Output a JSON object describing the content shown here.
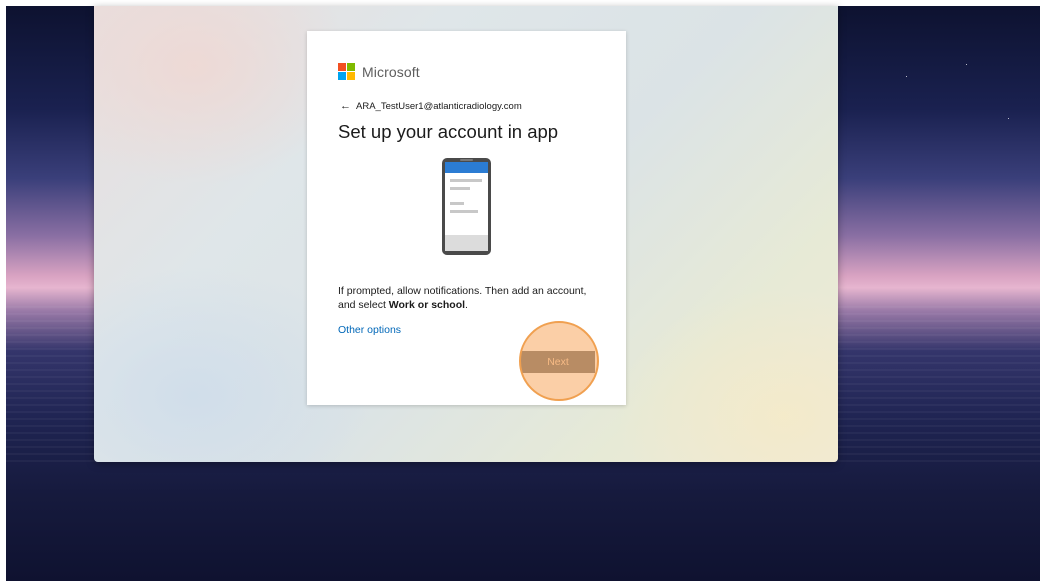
{
  "brand": {
    "name": "Microsoft",
    "logo_colors": [
      "#f25022",
      "#7fba00",
      "#00a4ef",
      "#ffb900"
    ]
  },
  "identity": {
    "back_icon": "back-arrow-icon",
    "back_glyph": "←",
    "email": "ARA_TestUser1@atlanticradiology.com"
  },
  "title": "Set up your account in app",
  "illustration": "phone-illustration",
  "description": {
    "text_before": "If prompted, allow notifications. Then add an account, and select ",
    "emphasis": "Work or school",
    "text_after": "."
  },
  "other_options_label": "Other options",
  "next_label": "Next",
  "colors": {
    "link": "#0067b8",
    "next_button_bg": "#6b6b6b",
    "highlight": "#f0a050",
    "phone_header": "#2b7cd3"
  }
}
